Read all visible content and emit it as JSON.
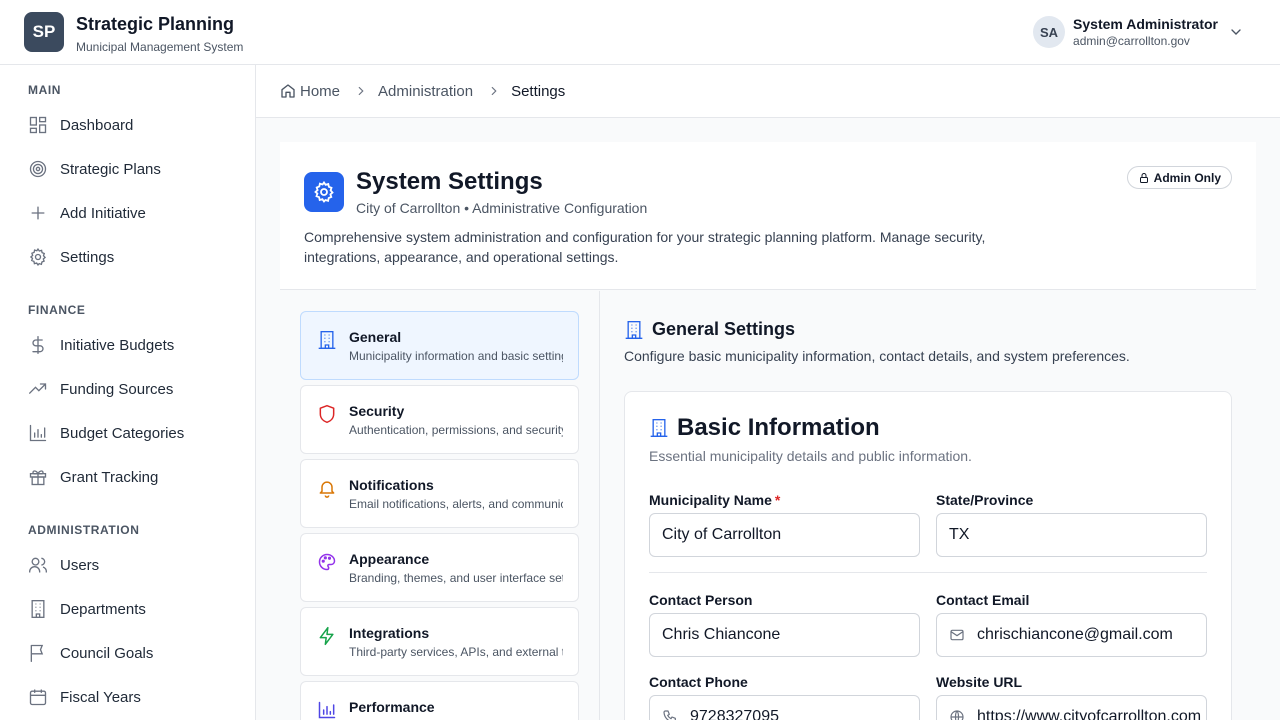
{
  "app": {
    "logo": "SP",
    "title": "Strategic Planning",
    "subtitle": "Municipal Management System"
  },
  "user": {
    "initials": "SA",
    "name": "System Administrator",
    "email": "admin@carrollton.gov"
  },
  "sidebar": {
    "sections": [
      {
        "title": "MAIN",
        "items": [
          {
            "label": "Dashboard",
            "icon": "dashboard-icon"
          },
          {
            "label": "Strategic Plans",
            "icon": "target-icon"
          },
          {
            "label": "Add Initiative",
            "icon": "plus-icon"
          },
          {
            "label": "Settings",
            "icon": "gear-icon"
          }
        ]
      },
      {
        "title": "FINANCE",
        "items": [
          {
            "label": "Initiative Budgets",
            "icon": "dollar-icon"
          },
          {
            "label": "Funding Sources",
            "icon": "trending-up-icon"
          },
          {
            "label": "Budget Categories",
            "icon": "bar-chart-icon"
          },
          {
            "label": "Grant Tracking",
            "icon": "gift-icon"
          }
        ]
      },
      {
        "title": "ADMINISTRATION",
        "items": [
          {
            "label": "Users",
            "icon": "users-icon"
          },
          {
            "label": "Departments",
            "icon": "building-icon"
          },
          {
            "label": "Council Goals",
            "icon": "flag-icon"
          },
          {
            "label": "Fiscal Years",
            "icon": "calendar-icon"
          }
        ]
      }
    ]
  },
  "breadcrumb": {
    "home": "Home",
    "parent": "Administration",
    "current": "Settings"
  },
  "header": {
    "title": "System Settings",
    "subtitle": "City of Carrollton • Administrative Configuration",
    "description": "Comprehensive system administration and configuration for your strategic planning platform. Manage security, integrations, appearance, and operational settings.",
    "badge": "Admin Only"
  },
  "tabs": [
    {
      "label": "General",
      "desc": "Municipality information and basic settings",
      "icon": "building-icon",
      "color": "#2563eb",
      "active": true
    },
    {
      "label": "Security",
      "desc": "Authentication, permissions, and security policies",
      "icon": "shield-icon",
      "color": "#dc2626",
      "active": false
    },
    {
      "label": "Notifications",
      "desc": "Email notifications, alerts, and communication",
      "icon": "bell-icon",
      "color": "#d97706",
      "active": false
    },
    {
      "label": "Appearance",
      "desc": "Branding, themes, and user interface settings",
      "icon": "palette-icon",
      "color": "#9333ea",
      "active": false
    },
    {
      "label": "Integrations",
      "desc": "Third-party services, APIs, and external tools",
      "icon": "zap-icon",
      "color": "#16a34a",
      "active": false
    },
    {
      "label": "Performance",
      "desc": "",
      "icon": "bar-chart-icon",
      "color": "#4f46e5",
      "active": false
    }
  ],
  "general": {
    "title": "General Settings",
    "description": "Configure basic municipality information, contact details, and system preferences.",
    "card_title": "Basic Information",
    "card_desc": "Essential municipality details and public information.",
    "fields": {
      "municipality_name": {
        "label": "Municipality Name",
        "required": "*",
        "value": "City of Carrollton"
      },
      "state": {
        "label": "State/Province",
        "value": "TX"
      },
      "contact_person": {
        "label": "Contact Person",
        "value": "Chris Chiancone"
      },
      "contact_email": {
        "label": "Contact Email",
        "value": "chrischiancone@gmail.com"
      },
      "contact_phone": {
        "label": "Contact Phone",
        "value": "9728327095"
      },
      "website": {
        "label": "Website URL",
        "value": "https://www.cityofcarrollton.com"
      }
    }
  },
  "colors": {
    "accent": "#2563eb",
    "logo_bg": "#3b4a5e"
  }
}
